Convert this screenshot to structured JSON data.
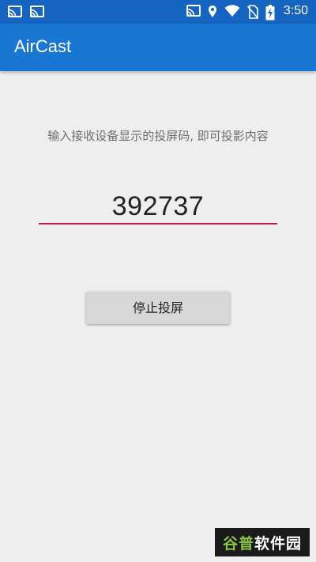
{
  "status_bar": {
    "time": "3:50",
    "left_icons": [
      "cast-icon",
      "cast-icon"
    ],
    "right_icons": [
      "cast-icon",
      "location-icon",
      "wifi-icon",
      "no-sim-icon",
      "battery-charging-icon"
    ]
  },
  "app_bar": {
    "title": "AirCast"
  },
  "main": {
    "instruction": "输入接收设备显示的投屏码, 即可投影内容",
    "code": "392737",
    "stop_button_label": "停止投屏"
  },
  "watermark": {
    "part1": "谷普",
    "part2": "软件园"
  },
  "colors": {
    "status_bar": "#1565c0",
    "app_bar": "#1976d2",
    "accent_underline": "#c2185b",
    "background": "#eeeeee",
    "button": "#d7d7d7"
  }
}
